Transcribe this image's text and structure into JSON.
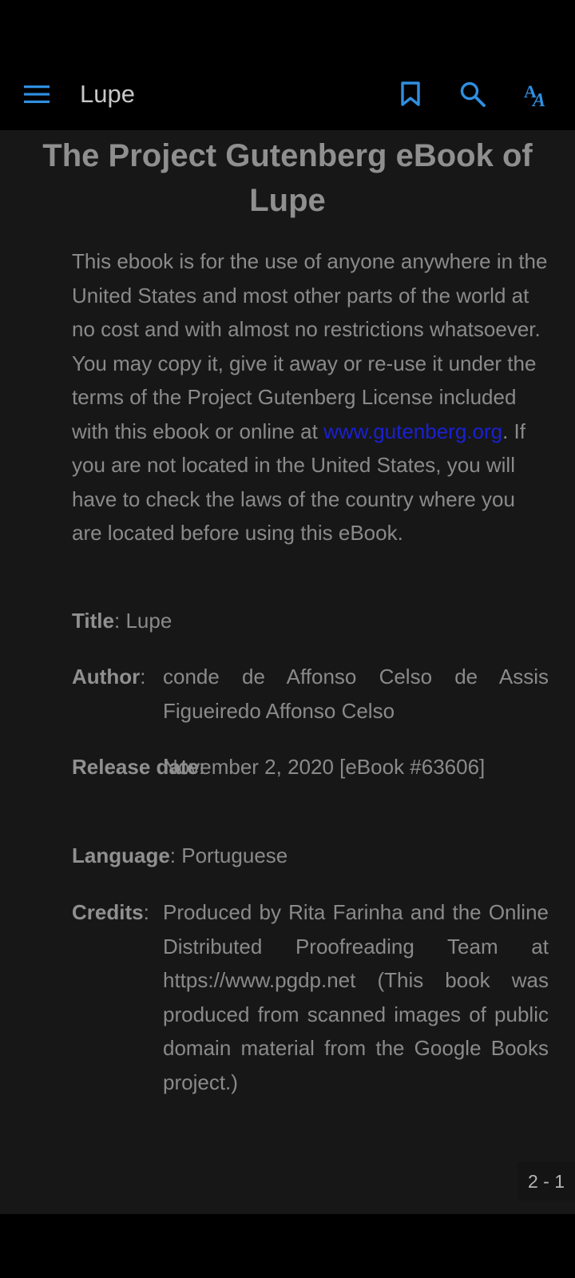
{
  "appbar": {
    "title": "Lupe",
    "accent": "#2f8fe0",
    "icons": [
      "menu-icon",
      "bookmark-icon",
      "search-icon",
      "text-size-icon"
    ]
  },
  "book": {
    "heading": "The Project Gutenberg eBook of Lupe",
    "intro_before_link": "This ebook is for the use of anyone anywhere in the United States and most other parts of the world at no cost and with almost no restrictions whatsoever. You may copy it, give it away or re-use it under the terms of the Project Gutenberg License included with this ebook or online at ",
    "intro_link": "www.gutenberg.org",
    "intro_after_link": ". If you are not located in the United States, you will have to check the laws of the country where you are located before using this eBook.",
    "title_label": "Title",
    "title_value": "Lupe",
    "author_label": "Author",
    "author_value": "conde de Affonso Celso de Assis Figueiredo Affonso Celso",
    "release_label": "Release date",
    "release_value": "November 2, 2020 [eBook #63606]",
    "language_label": "Language",
    "language_value": "Portuguese",
    "credits_label": "Credits",
    "credits_value": "Produced by Rita Farinha and the Online Distributed Proofreading Team at https://www.pgdp.net (This book was produced from scanned images of public domain material from the Google Books project.)"
  },
  "page_indicator": "2 - 1"
}
